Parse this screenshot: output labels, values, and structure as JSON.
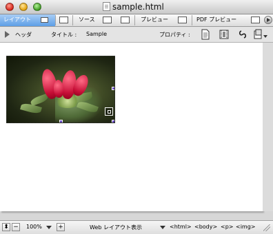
{
  "window": {
    "title": "sample.html"
  },
  "tabs": {
    "layout": "レイアウト",
    "source": "ソース",
    "preview": "プレビュー",
    "pdf_preview": "PDF プレビュー"
  },
  "header": {
    "section_label": "ヘッダ",
    "title_label": "タイトル :",
    "title_value": "Sample",
    "properties_label": "プロパティ :"
  },
  "image": {
    "description_icon": "image-placeholder"
  },
  "status": {
    "zoom": "100%",
    "view_mode": "Web レイアウト表示",
    "breadcrumb": [
      "<html>",
      "<body>",
      "<p>",
      "<img>"
    ]
  }
}
